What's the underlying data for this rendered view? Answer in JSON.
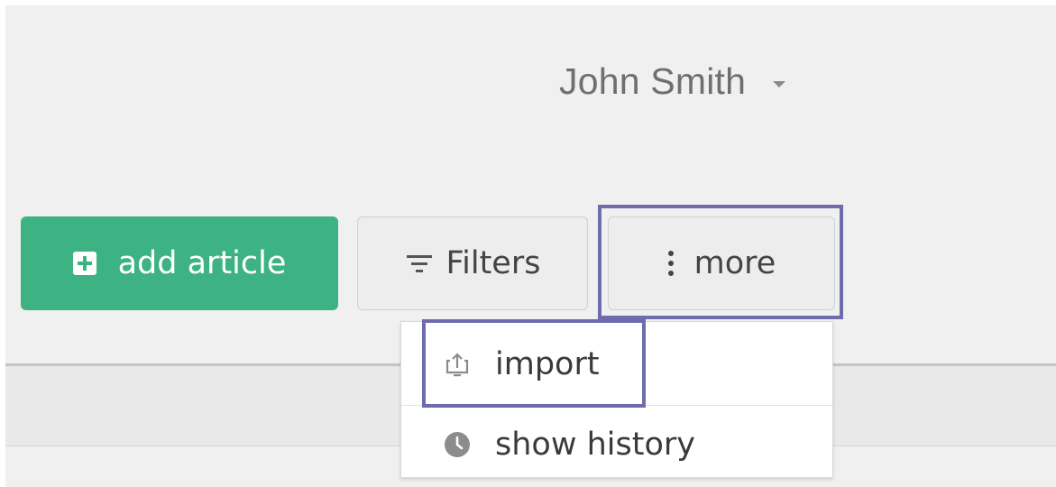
{
  "header": {
    "user_name": "John Smith",
    "user_menu_icon": "caret-down-icon"
  },
  "toolbar": {
    "add_article_label": "add article",
    "add_article_icon": "plus-square-icon",
    "filters_label": "Filters",
    "filters_icon": "filter-icon",
    "more_label": "more",
    "more_icon": "vertical-dots-icon"
  },
  "more_menu": {
    "items": [
      {
        "label": "import",
        "icon": "upload-icon"
      },
      {
        "label": "show history",
        "icon": "clock-icon"
      }
    ]
  },
  "colors": {
    "primary": "#3db383",
    "highlight": "#6f6cae",
    "background": "#f0f0f0"
  }
}
